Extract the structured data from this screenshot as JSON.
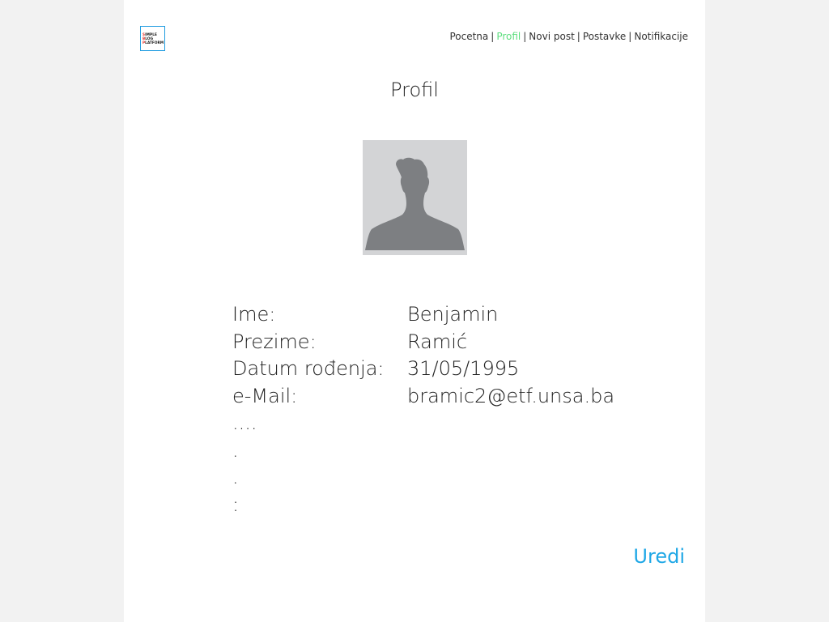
{
  "logo": {
    "lines": [
      "Simple",
      "Blog",
      "Platform"
    ]
  },
  "nav": {
    "items": [
      {
        "label": "Pocetna",
        "active": false
      },
      {
        "label": "Profil",
        "active": true
      },
      {
        "label": "Novi post",
        "active": false
      },
      {
        "label": "Postavke",
        "active": false
      },
      {
        "label": "Notifikacije",
        "active": false
      }
    ],
    "separator": "|"
  },
  "page_title": "Profil",
  "avatar_icon": "user-silhouette-icon",
  "profile": {
    "fields": [
      {
        "label": "Ime:",
        "value": "Benjamin"
      },
      {
        "label": "Prezime:",
        "value": "Ramić"
      },
      {
        "label": "Datum rođenja:",
        "value": "31/05/1995"
      },
      {
        "label": "e-Mail:",
        "value": "bramic2@etf.unsa.ba"
      }
    ],
    "trailing_lines": [
      "....",
      ".",
      ".",
      ":"
    ]
  },
  "edit_link": "Uredi",
  "colors": {
    "accent_green": "#5dde7f",
    "link_blue": "#1ea7e6",
    "logo_border": "#1e9be0",
    "avatar_bg": "#d3d4d6",
    "avatar_figure": "#7d7f82"
  }
}
